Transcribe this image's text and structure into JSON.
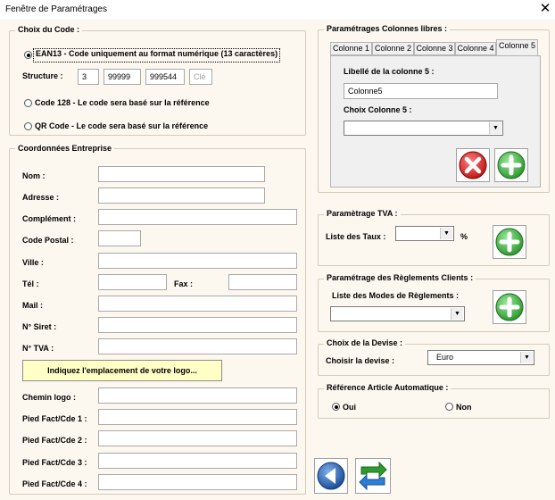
{
  "window": {
    "title": "Fenêtre de Paramétrages",
    "close_glyph": "✕"
  },
  "code_choice": {
    "legend": "Choix du Code :",
    "ean13_label": "EAN13  - Code uniquement au format numérique (13 caractères)",
    "structure_label": "Structure :",
    "structure_values": [
      "3",
      "99999",
      "999544"
    ],
    "structure_key_placeholder": "Clé",
    "code128_label": "Code 128 - Le code sera basé sur la référence",
    "qr_label": "QR Code - Le code sera basé sur la référence",
    "selected": "EAN13"
  },
  "company": {
    "legend": "Coordonnées Entreprise",
    "labels": {
      "name": "Nom :",
      "address": "Adresse :",
      "complement": "Complément :",
      "postal": "Code Postal :",
      "city": "Ville :",
      "phone": "Tél :",
      "fax": "Fax :",
      "mail": "Mail :",
      "siret": "N° Siret :",
      "vat": "N° TVA :",
      "logo_path": "Chemin logo :",
      "footer1": "Pied Fact/Cde 1 :",
      "footer2": "Pied Fact/Cde 2 :",
      "footer3": "Pied Fact/Cde 3 :",
      "footer4": "Pied Fact/Cde 4 :"
    },
    "logo_button": "Indiquez l'emplacement de votre logo..."
  },
  "free_columns": {
    "legend": "Paramétrages Colonnes libres :",
    "tabs": [
      "Colonne 1",
      "Colonne 2",
      "Colonne 3",
      "Colonne 4",
      "Colonne 5"
    ],
    "active_tab": "Colonne 5",
    "column_label_title": "Libellé de la colonne 5 :",
    "column_label_value": "Colonne5",
    "column_choice_title": "Choix Colonne 5 :",
    "column_choice_value": ""
  },
  "vat": {
    "legend": "Paramètrage TVA :",
    "rates_label": "Liste des Taux :",
    "rate_value": "",
    "percent": "%"
  },
  "payments": {
    "legend": "Paramétrage des Règlements Clients :",
    "modes_label": "Liste des Modes de Règlements :",
    "mode_value": ""
  },
  "currency": {
    "legend": "Choix de la Devise :",
    "label": "Choisir la devise :",
    "value": "Euro"
  },
  "auto_ref": {
    "legend": "Référence Article Automatique :",
    "yes": "Oui",
    "no": "Non",
    "selected": "Oui"
  },
  "colors": {
    "background": "#fcf7ef",
    "add_green": "#3fae3f",
    "delete_red": "#d83030",
    "nav_blue": "#2a5fa8",
    "logo_button_yellow": "#ffffc6"
  }
}
